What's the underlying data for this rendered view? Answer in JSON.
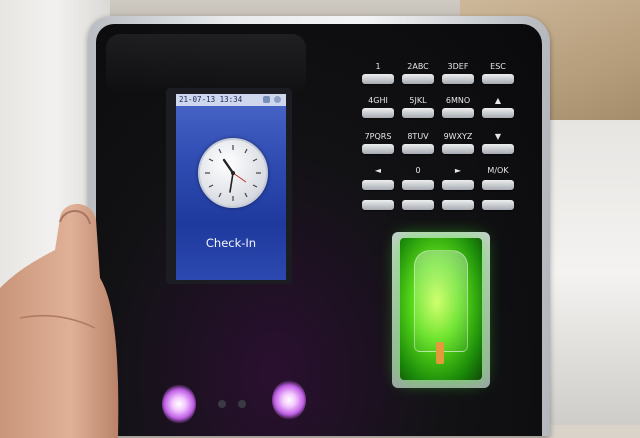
{
  "screen": {
    "status_time": "21-07-13 13:34",
    "message": "Check-In"
  },
  "keypad": {
    "keys": [
      "1",
      "2ABC",
      "3DEF",
      "ESC",
      "4GHI",
      "5JKL",
      "6MNO",
      "▲",
      "7PQRS",
      "8TUV",
      "9WXYZ",
      "▼",
      "◄",
      "0",
      "►",
      "M/OK"
    ]
  },
  "colors": {
    "screen_blue": "#2f4db3",
    "fingerprint_glow": "#5fe11a",
    "button_glow": "#c060e6"
  },
  "icons": [
    "clock-icon",
    "status-icon",
    "fingerprint-sensor"
  ]
}
